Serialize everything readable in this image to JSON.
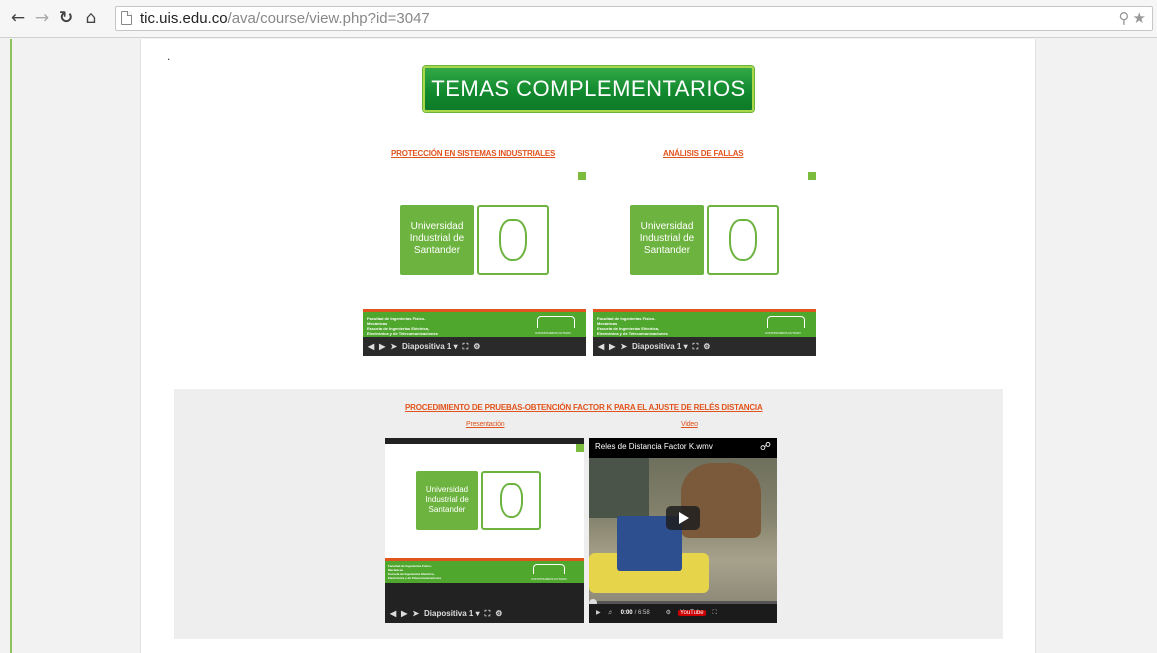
{
  "browser": {
    "url_host": "tic.uis.edu.co",
    "url_path": "/ava/course/view.php?id=3047"
  },
  "page": {
    "dot": ".",
    "banner": "TEMAS COMPLEMENTARIOS",
    "links": {
      "proteccion": "PROTECCIÓN EN SISTEMAS INDUSTRIALES",
      "analisis": "ANÁLISIS DE FALLAS",
      "procedimiento": "PROCEDIMIENTO DE PRUEBAS-OBTENCIÓN FACTOR K PARA EL AJUSTE DE RELÉS DISTANCIA",
      "presentacion": "Presentación",
      "video": "Video"
    },
    "slide": {
      "logo_line1": "Universidad",
      "logo_line2": "Industrial de",
      "logo_line3": "Santander",
      "footer_line1": "Facultad de Ingenierías Físico-",
      "footer_line2": "Mecánicas",
      "footer_line3": "Escuela de Ingenierías Eléctrica,",
      "footer_line4": "Electrónica y de Telecomunicaciones",
      "footer_tag": "CONSTRUIMOS FUTURO",
      "slide_label": "Diapositiva 1"
    },
    "video": {
      "title": "Reles de Distancia Factor K.wmv",
      "time_current": "0:00",
      "time_total": "/ 6:58",
      "brand": "YouTube"
    }
  }
}
